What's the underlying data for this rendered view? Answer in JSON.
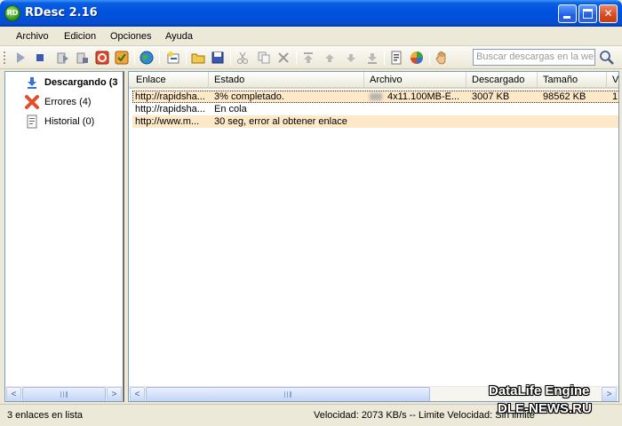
{
  "window": {
    "title": "RDesc 2.16",
    "app_icon_text": "RD"
  },
  "menu": {
    "items": [
      "Archivo",
      "Edicion",
      "Opciones",
      "Ayuda"
    ]
  },
  "toolbar": {
    "search_placeholder": "Buscar descargas en la web",
    "buttons": [
      "play-icon",
      "stop-icon",
      "start-all-icon",
      "stop-all-icon",
      "delete-red-icon",
      "schedule-icon",
      "globe-icon",
      "new-link-icon",
      "open-folder-icon",
      "save-icon",
      "cut-icon",
      "copy-icon",
      "delete-icon",
      "move-top-icon",
      "move-up-icon",
      "move-down-icon",
      "move-bottom-icon",
      "properties-icon",
      "options-icon",
      "hand-icon"
    ]
  },
  "sidebar": {
    "items": [
      {
        "label": "Descargando (3",
        "icon": "download-arrow-icon",
        "active": true
      },
      {
        "label": "Errores (4)",
        "icon": "error-x-icon",
        "active": false
      },
      {
        "label": "Historial (0)",
        "icon": "history-doc-icon",
        "active": false
      }
    ]
  },
  "table": {
    "columns": [
      "Enlace",
      "Estado",
      "Archivo",
      "Descargado",
      "Tamaño",
      "V"
    ],
    "rows": [
      {
        "enlace": "http://rapidsha...",
        "estado": "3% completado.",
        "archivo": "4x11.100MB-E...",
        "descargado": "3007 KB",
        "tamano": "98562 KB",
        "v": "1"
      },
      {
        "enlace": "http://rapidsha...",
        "estado": "En cola",
        "archivo": "",
        "descargado": "",
        "tamano": "",
        "v": ""
      },
      {
        "enlace": "http://www.m...",
        "estado": "30 seg, error al obtener enlace",
        "archivo": "",
        "descargado": "",
        "tamano": "",
        "v": ""
      }
    ]
  },
  "scrollbar": {
    "left_arrow": "<",
    "right_arrow": ">"
  },
  "status": {
    "left": "3 enlaces en lista",
    "right": "Velocidad: 2073 KB/s  --  Limite Velocidad: Sin limite"
  },
  "watermark": {
    "line1": "DataLife Engine",
    "line2": "DLE-NEWS.RU"
  },
  "colors": {
    "titlebar": "#0053e0",
    "row_highlight": "#fde8c8",
    "window_bg": "#ece9d8"
  }
}
